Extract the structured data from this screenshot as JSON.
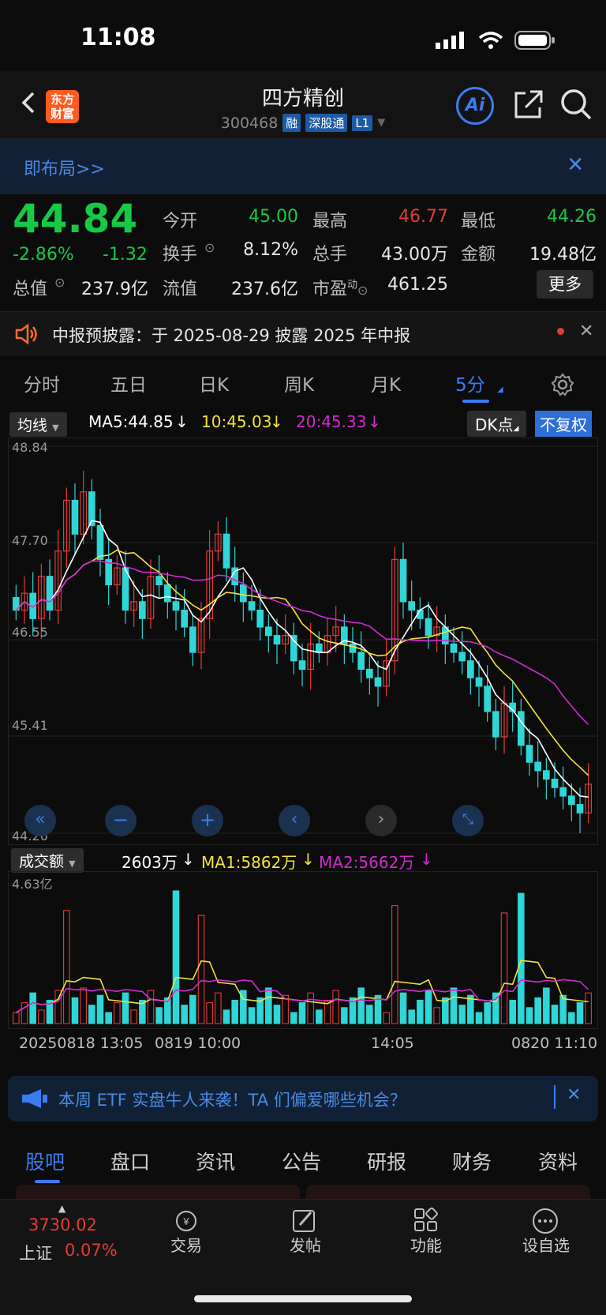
{
  "status": {
    "time": "11:08"
  },
  "nav": {
    "logo_line1": "东方",
    "logo_line2": "财富",
    "title": "四方精创",
    "code": "300468",
    "tag_rong": "融",
    "tag_sgt": "深股通",
    "tag_l1": "L1",
    "ai_label": "Ai"
  },
  "banner": {
    "text": "即布局>>"
  },
  "quote": {
    "price": "44.84",
    "chg_pct": "-2.86%",
    "chg_abs": "-1.32",
    "open_label": "今开",
    "open": "45.00",
    "high_label": "最高",
    "high": "46.77",
    "low_label": "最低",
    "low": "44.26",
    "turnover_label": "换手",
    "turnover": "8.12%",
    "volume_label": "总手",
    "volume": "43.00万",
    "amount_label": "金额",
    "amount": "19.48亿",
    "mktcap_label": "总值",
    "mktcap": "237.9亿",
    "float_label": "流值",
    "float": "237.6亿",
    "pe_label": "市盈",
    "pe_sup": "动",
    "pe": "461.25",
    "more": "更多"
  },
  "notice": {
    "text": "中报预披露：于 2025-08-29 披露 2025 年中报"
  },
  "ktabs": [
    "分时",
    "五日",
    "日K",
    "周K",
    "月K",
    "5分"
  ],
  "indicator": {
    "selector": "均线",
    "ma5": "MA5:44.85",
    "ma10": "10:45.03",
    "ma20": "20:45.33",
    "dk": "DK点",
    "fq": "不复权"
  },
  "price_axis": [
    "48.84",
    "47.70",
    "46.55",
    "45.41",
    "44.26"
  ],
  "volume": {
    "selector": "成交额",
    "cur": "2603万",
    "ma1": "MA1:5862万",
    "ma2": "MA2:5662万",
    "max": "4.63亿"
  },
  "time_axis": [
    "20250818 13:05",
    "0819 10:00",
    "14:05",
    "0820 11:10"
  ],
  "promo": {
    "text": "本周 ETF 实盘牛人来袭！TA 们偏爱哪些机会？"
  },
  "btabs": [
    "股吧",
    "盘口",
    "资讯",
    "公告",
    "研报",
    "财务",
    "资料"
  ],
  "footer": {
    "index_val": "3730.02",
    "index_name": "上证",
    "index_chg": "0.07%",
    "trade": "交易",
    "post": "发帖",
    "func": "功能",
    "watch": "设自选"
  },
  "colors": {
    "up": "#e63a3a",
    "down": "#2ed6d6",
    "green": "#16c947",
    "accent": "#3a7df0",
    "ma5": "#ffffff",
    "ma10": "#f2e23a",
    "ma20": "#d12ad1"
  },
  "chart_data": {
    "type": "candlestick",
    "ylim": [
      44.26,
      48.84
    ],
    "y_ticks": [
      48.84,
      47.7,
      46.55,
      45.41,
      44.26
    ],
    "closes": [
      46.9,
      47.1,
      46.8,
      47.3,
      46.9,
      47.6,
      48.2,
      47.8,
      48.3,
      47.9,
      47.5,
      47.2,
      47.4,
      46.9,
      47.0,
      46.8,
      47.3,
      47.2,
      47.0,
      46.9,
      46.7,
      46.4,
      46.8,
      47.6,
      47.8,
      47.4,
      47.2,
      47.0,
      46.9,
      46.7,
      46.6,
      46.5,
      46.6,
      46.3,
      46.2,
      46.5,
      46.4,
      46.6,
      46.7,
      46.5,
      46.4,
      46.2,
      46.1,
      46.0,
      46.3,
      47.5,
      47.0,
      46.9,
      46.8,
      46.6,
      46.7,
      46.5,
      46.4,
      46.3,
      46.1,
      46.0,
      45.7,
      45.4,
      45.8,
      45.7,
      45.3,
      45.1,
      45.0,
      44.9,
      44.8,
      44.7,
      44.6,
      44.5,
      44.84
    ]
  }
}
